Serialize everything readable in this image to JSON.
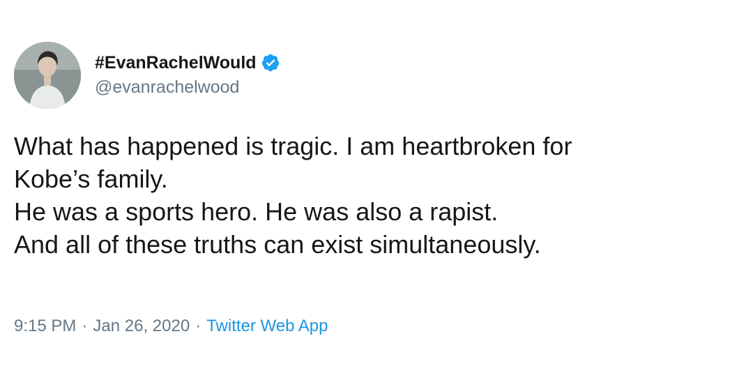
{
  "author": {
    "display_name": "#EvanRachelWould",
    "handle": "@evanrachelwood",
    "verified_icon": "verified-badge-icon",
    "avatar": "profile-photo"
  },
  "tweet": {
    "lines": [
      "What has happened is tragic. I am heartbroken for",
      "Kobe’s family.",
      "He was a sports hero. He was also a rapist.",
      "And all of these truths can exist simultaneously."
    ]
  },
  "meta": {
    "time": "9:15 PM",
    "date": "Jan 26, 2020",
    "separator": "·",
    "source": "Twitter Web App"
  },
  "colors": {
    "text": "#14171a",
    "secondary": "#657786",
    "link": "#1b95e0",
    "verified": "#1da1f2"
  }
}
